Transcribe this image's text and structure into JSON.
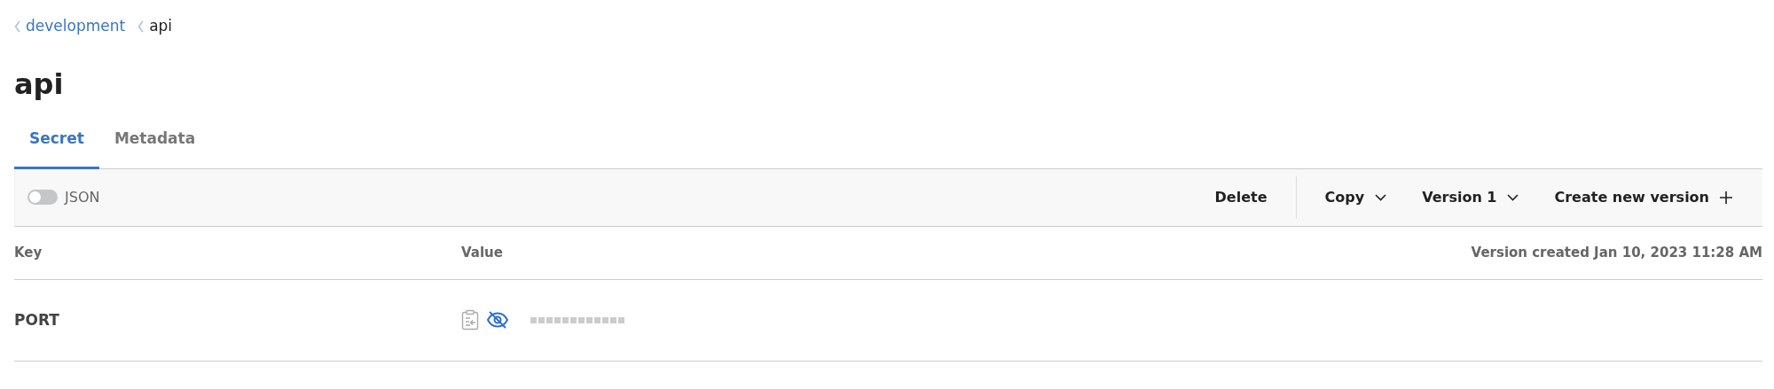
{
  "breadcrumbs": [
    {
      "label": "development",
      "link": true
    },
    {
      "label": "api",
      "link": false
    }
  ],
  "title": "api",
  "tabs": [
    {
      "label": "Secret",
      "selected": true
    },
    {
      "label": "Metadata",
      "selected": false
    }
  ],
  "toolbar": {
    "json_toggle": {
      "label": "JSON",
      "on": false
    },
    "buttons": [
      {
        "label": "Delete",
        "kind": "plain"
      },
      {
        "label": "Copy",
        "kind": "dropdown"
      },
      {
        "label": "Version 1",
        "kind": "dropdown"
      },
      {
        "label": "Create new version",
        "kind": "add"
      }
    ]
  },
  "table": {
    "columns": [
      "Key",
      "Value"
    ],
    "version_note": "Version created Jan 10, 2023 11:28 AM",
    "rows": [
      {
        "key": "PORT",
        "masked": true
      }
    ]
  }
}
